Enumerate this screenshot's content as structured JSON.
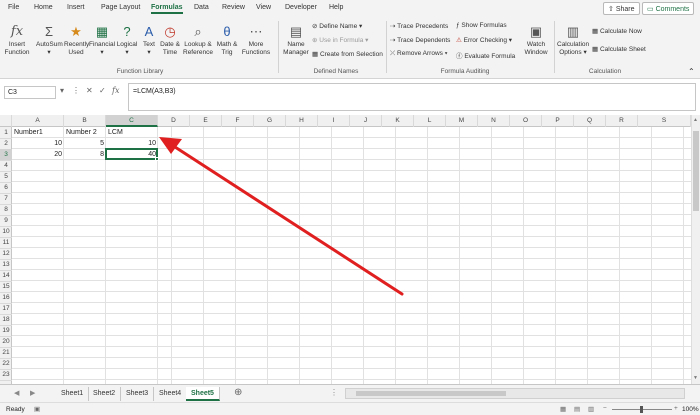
{
  "ribbon_tabs": [
    "File",
    "Home",
    "Insert",
    "Page Layout",
    "Formulas",
    "Data",
    "Review",
    "View",
    "Developer",
    "Help"
  ],
  "active_tab": "Formulas",
  "top_buttons": {
    "share": "Share",
    "comments": "Comments"
  },
  "function_library": {
    "insert_function": [
      "Insert",
      "Function"
    ],
    "autosum": "AutoSum",
    "recently_used": [
      "Recently",
      "Used"
    ],
    "financial": "Financial",
    "logical": "Logical",
    "text": "Text",
    "date_time": [
      "Date &",
      "Time"
    ],
    "lookup_reference": [
      "Lookup &",
      "Reference"
    ],
    "math_trig": [
      "Math &",
      "Trig"
    ],
    "more_functions": [
      "More",
      "Functions"
    ],
    "group_label": "Function Library"
  },
  "defined_names": {
    "name_manager": [
      "Name",
      "Manager"
    ],
    "define_name": "Define Name",
    "use_in_formula": "Use in Formula",
    "create_from_selection": "Create from Selection",
    "group_label": "Defined Names"
  },
  "formula_auditing": {
    "trace_precedents": "Trace Precedents",
    "trace_dependents": "Trace Dependents",
    "remove_arrows": "Remove Arrows",
    "show_formulas": "Show Formulas",
    "error_checking": "Error Checking",
    "evaluate_formula": "Evaluate Formula",
    "watch_window": [
      "Watch",
      "Window"
    ],
    "group_label": "Formula Auditing"
  },
  "calculation": {
    "calc_options": [
      "Calculation",
      "Options"
    ],
    "calculate_now": "Calculate Now",
    "calculate_sheet": "Calculate Sheet",
    "group_label": "Calculation"
  },
  "name_box": "C3",
  "formula": "=LCM(A3,B3)",
  "columns": [
    "A",
    "B",
    "C",
    "D",
    "E",
    "F",
    "G",
    "H",
    "I",
    "J",
    "K",
    "L",
    "M",
    "N",
    "O",
    "P",
    "Q",
    "R",
    "S"
  ],
  "rows": [
    "1",
    "2",
    "3",
    "4",
    "5",
    "6",
    "7",
    "8",
    "9",
    "10",
    "11",
    "12",
    "13",
    "14",
    "15",
    "16",
    "17",
    "18",
    "19",
    "20",
    "21",
    "22",
    "23"
  ],
  "cells": {
    "A1": "Number1",
    "B1": "Number 2",
    "C1": "LCM",
    "A2": "10",
    "B2": "5",
    "C2": "10",
    "A3": "20",
    "B3": "8",
    "C3": "40"
  },
  "sheets": [
    "Sheet1",
    "Sheet2",
    "Sheet3",
    "Sheet4",
    "Sheet5"
  ],
  "active_sheet": "Sheet5",
  "status": {
    "ready": "Ready",
    "zoom": "100%"
  },
  "colors": {
    "accent": "#1e7145",
    "arrow": "#e02020"
  }
}
